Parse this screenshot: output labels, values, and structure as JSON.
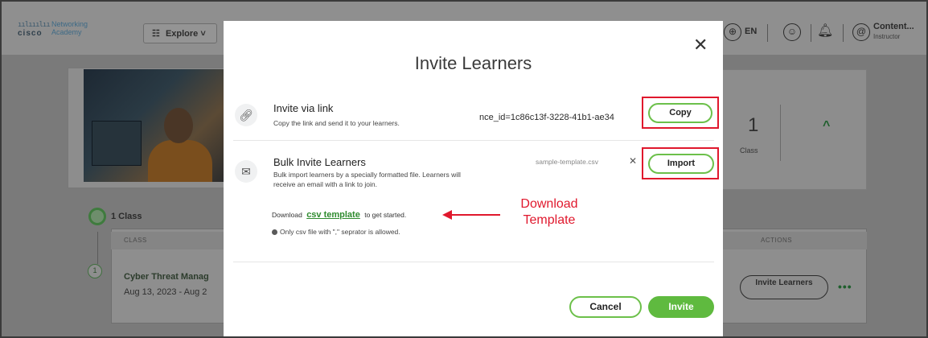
{
  "header": {
    "logo_bars": "ıılııılıı",
    "logo_brand": "cisco",
    "logo_product": "Networking Academy",
    "explore_label": "Explore",
    "language": "EN",
    "user_name": "Content...",
    "user_role": "Instructor"
  },
  "background": {
    "stat_value": "1",
    "stat_label": "Class",
    "class_count": "1 Class",
    "col_class": "CLASS",
    "col_actions": "ACTIONS",
    "row_index": "1",
    "course_name": "Cyber Threat Manag",
    "course_dates": "Aug 13, 2023 - Aug 2",
    "invite_learners_label": "Invite Learners",
    "more_label": "•••"
  },
  "modal": {
    "title": "Invite Learners",
    "close_glyph": "✕",
    "link_section": {
      "title": "Invite via link",
      "description": "Copy the link and send it to your learners.",
      "link_value": "nce_id=1c86c13f-3228-41b1-ae34",
      "copy_label": "Copy"
    },
    "bulk_section": {
      "title": "Bulk Invite Learners",
      "description": "Bulk import learners by a specially formatted file. Learners will receive an email with a link to join.",
      "file_name": "sample-template.csv",
      "remove_glyph": "✕",
      "import_label": "Import"
    },
    "download_prefix": "Download",
    "download_link": "csv template",
    "download_suffix": "to get started.",
    "note": "Only csv file with \",\" seprator is allowed.",
    "cancel_label": "Cancel",
    "invite_label": "Invite"
  },
  "annotation": {
    "text_line1": "Download",
    "text_line2": "Template",
    "color": "#e0182d"
  },
  "colors": {
    "accent_green": "#6cc04a",
    "invite_green": "#5fba3f",
    "highlight_red": "#e0182d"
  }
}
